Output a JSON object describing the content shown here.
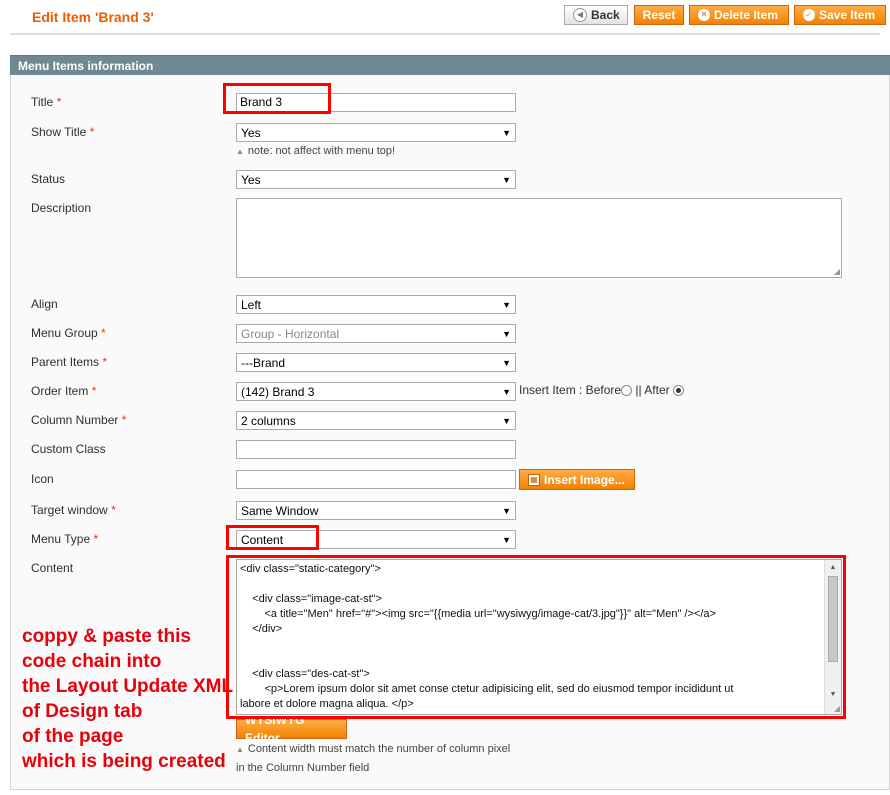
{
  "header": {
    "title": "Edit Item 'Brand 3'",
    "buttons": {
      "back": "Back",
      "reset": "Reset",
      "delete": "Delete Item",
      "save": "Save Item"
    }
  },
  "section": {
    "title": "Menu Items information"
  },
  "form": {
    "title": {
      "label": "Title",
      "value": "Brand 3"
    },
    "show_title": {
      "label": "Show Title",
      "value": "Yes",
      "note": "note: not affect with menu top!"
    },
    "status": {
      "label": "Status",
      "value": "Yes"
    },
    "description": {
      "label": "Description",
      "value": ""
    },
    "align": {
      "label": "Align",
      "value": "Left"
    },
    "menu_group": {
      "label": "Menu Group",
      "value": "Group - Horizontal"
    },
    "parent_items": {
      "label": "Parent Items",
      "value": "---Brand"
    },
    "order_item": {
      "label": "Order Item",
      "value": "(142) Brand 3",
      "insert_label": "Insert Item : Before",
      "after_label": "|| After",
      "selected": "After"
    },
    "column_number": {
      "label": "Column Number",
      "value": "2 columns"
    },
    "custom_class": {
      "label": "Custom Class",
      "value": ""
    },
    "icon": {
      "label": "Icon",
      "value": "",
      "insert_button": "Insert Image..."
    },
    "target_window": {
      "label": "Target window",
      "value": "Same Window"
    },
    "menu_type": {
      "label": "Menu Type",
      "value": "Content"
    },
    "content": {
      "label": "Content",
      "code": "<div class=\"static-category\">\n\n    <div class=\"image-cat-st\">\n        <a title=\"Men\" href=\"#\"><img src=\"{{media url=\"wysiwyg/image-cat/3.jpg\"}}\" alt=\"Men\" /></a>\n    </div>\n\n\n    <div class=\"des-cat-st\">\n        <p>Lorem ipsum dolor sit amet conse ctetur adipisicing elit, sed do eiusmod tempor incididunt ut\nlabore et dolore magna aliqua. </p>\n    </div>",
      "wysiwyg_button": "WYSIWYG Editor",
      "note_line1": "Content width must match the number of column pixel",
      "note_line2": "in the Column Number field"
    },
    "required_marker": "*"
  },
  "annotation": {
    "lines": [
      "coppy & paste this",
      "code chain into",
      "the Layout Update XML",
      "of Design tab",
      "of the page",
      "which is being created"
    ]
  },
  "colors": {
    "accent": "#eb5e00",
    "button": "#f18200",
    "section_header": "#6f8992",
    "highlight": "#ff0000"
  }
}
